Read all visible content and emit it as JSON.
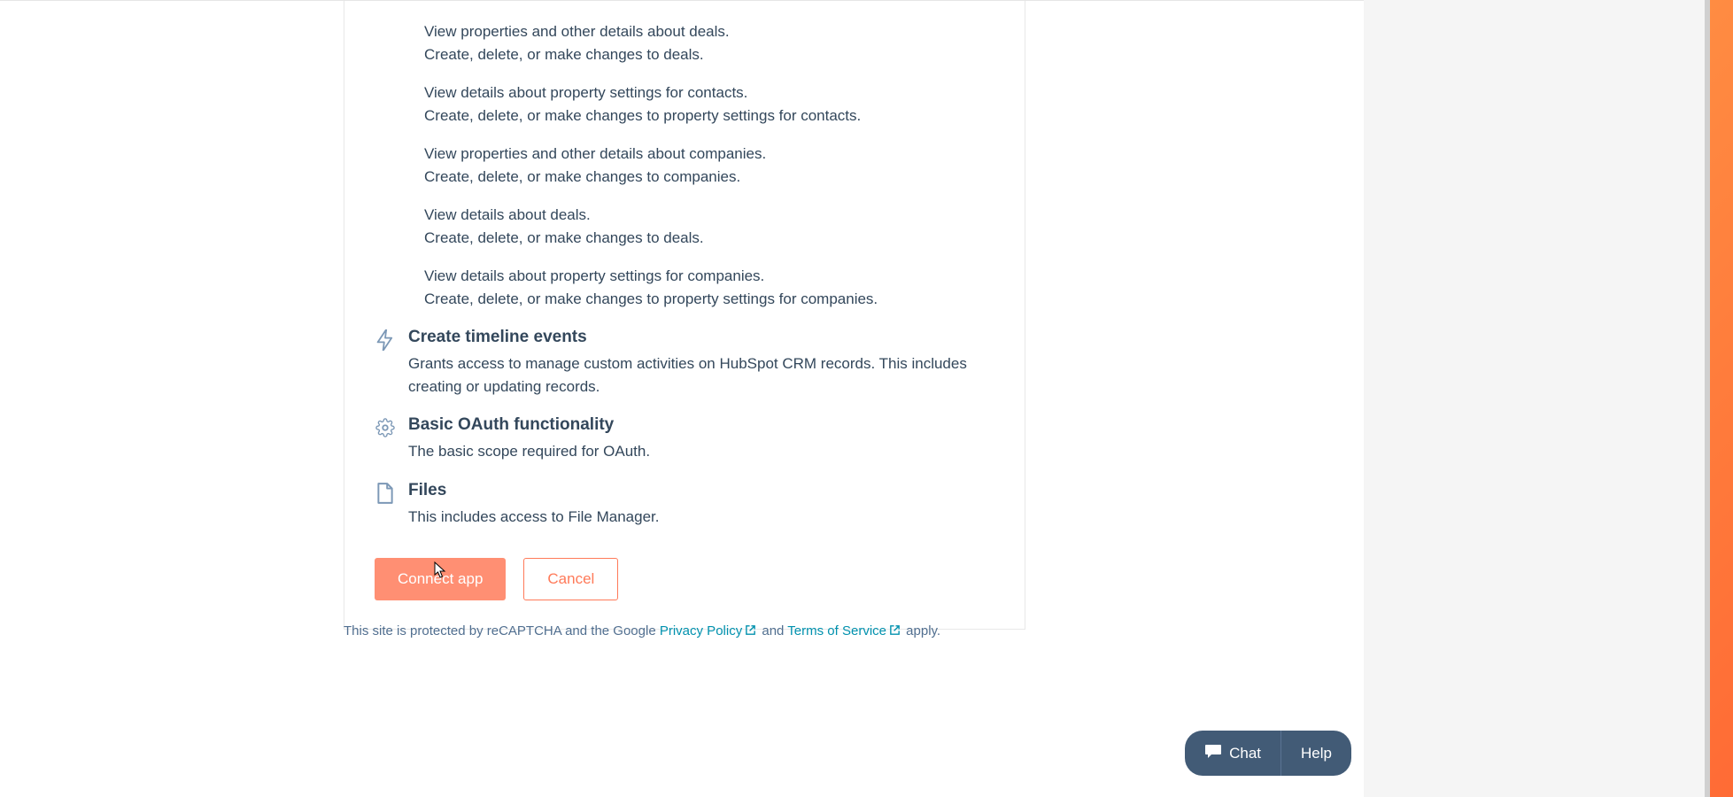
{
  "permissions": [
    {
      "lines": [
        "View properties and other details about deals.",
        "Create, delete, or make changes to deals."
      ]
    },
    {
      "lines": [
        "View details about property settings for contacts.",
        "Create, delete, or make changes to property settings for contacts."
      ]
    },
    {
      "lines": [
        "View properties and other details about companies.",
        "Create, delete, or make changes to companies."
      ]
    },
    {
      "lines": [
        "View details about deals.",
        "Create, delete, or make changes to deals."
      ]
    },
    {
      "lines": [
        "View details about property settings for companies.",
        "Create, delete, or make changes to property settings for companies."
      ]
    }
  ],
  "scopes": [
    {
      "icon": "lightning-icon",
      "title": "Create timeline events",
      "description": "Grants access to manage custom activities on HubSpot CRM records. This includes creating or updating records."
    },
    {
      "icon": "gear-icon",
      "title": "Basic OAuth functionality",
      "description": "The basic scope required for OAuth."
    },
    {
      "icon": "file-icon",
      "title": "Files",
      "description": "This includes access to File Manager."
    }
  ],
  "buttons": {
    "connect": "Connect app",
    "cancel": "Cancel"
  },
  "footer": {
    "prefix": "This site is protected by reCAPTCHA and the Google ",
    "privacy": "Privacy Policy",
    "and": " and ",
    "terms": "Terms of Service",
    "suffix": " apply."
  },
  "widgets": {
    "chat": "Chat",
    "help": "Help"
  }
}
